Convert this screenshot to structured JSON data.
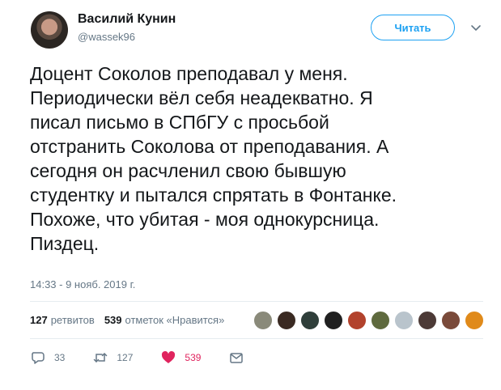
{
  "author": {
    "name": "Василий Кунин",
    "handle": "@wassek96",
    "follow_label": "Читать"
  },
  "tweet": {
    "lines": [
      "Доцент Соколов преподавал у меня.",
      "Периодически вёл себя неадекватно. Я",
      "писал письмо в СПбГУ с просьбой",
      "отстранить Соколова от преподавания. А",
      "сегодня он расчленил свою бывшую",
      "студентку и пытался спрятать в Фонтанке.",
      "Похоже, что убитая - моя однокурсница.",
      "Пиздец."
    ],
    "timestamp": "14:33 - 9 нояб. 2019 г."
  },
  "stats": {
    "retweets_count": "127",
    "retweets_label": "ретвитов",
    "likes_count": "539",
    "likes_label": "отметок «Нравится»"
  },
  "liker_avatars": [
    {
      "color": "#8a8a7a"
    },
    {
      "color": "#3a2a22"
    },
    {
      "color": "#2f3e3a"
    },
    {
      "color": "#202020"
    },
    {
      "color": "#b2422c"
    },
    {
      "color": "#5f6a3e"
    },
    {
      "color": "#b9c4cc"
    },
    {
      "color": "#4c3a36"
    },
    {
      "color": "#7a4a3a"
    },
    {
      "color": "#e08a1a"
    }
  ],
  "actions": {
    "replies": "33",
    "retweets": "127",
    "likes": "539"
  },
  "colors": {
    "accent": "#1da1f2",
    "like": "#e0245e",
    "muted": "#657786"
  }
}
